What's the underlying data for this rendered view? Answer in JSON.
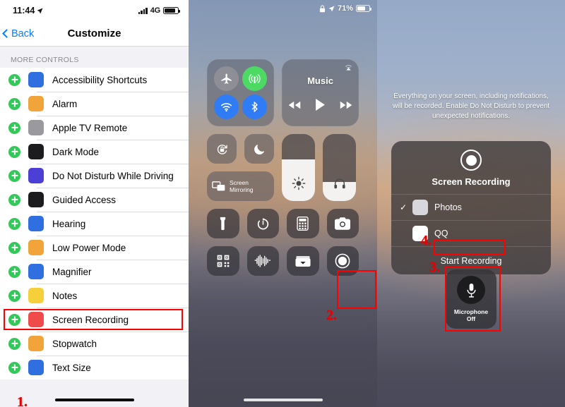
{
  "panel1": {
    "status": {
      "time": "11:44",
      "location_icon": "location-arrow-icon",
      "network": "4G",
      "signal_icon": "signal-bars-icon",
      "battery_icon": "battery-icon"
    },
    "nav": {
      "back_label": "Back",
      "title": "Customize"
    },
    "section_header": "MORE CONTROLS",
    "items": [
      {
        "label": "Accessibility Shortcuts",
        "icon": "accessibility-icon",
        "color": "#2f6fe0",
        "glyph": "ⓘ"
      },
      {
        "label": "Alarm",
        "icon": "alarm-icon",
        "color": "#f0a43a",
        "glyph": "⏰"
      },
      {
        "label": "Apple TV Remote",
        "icon": "apple-tv-remote-icon",
        "color": "#9a9a9e",
        "glyph": "▮"
      },
      {
        "label": "Dark Mode",
        "icon": "dark-mode-icon",
        "color": "#1c1c1e",
        "glyph": "◑"
      },
      {
        "label": "Do Not Disturb While Driving",
        "icon": "car-icon",
        "color": "#4b3fd6",
        "glyph": "Ὡ7"
      },
      {
        "label": "Guided Access",
        "icon": "guided-access-icon",
        "color": "#1c1c1e",
        "glyph": "▣"
      },
      {
        "label": "Hearing",
        "icon": "hearing-icon",
        "color": "#2f6fe0",
        "glyph": "ὄ2"
      },
      {
        "label": "Low Power Mode",
        "icon": "low-power-mode-icon",
        "color": "#f0a43a",
        "glyph": "ὐB"
      },
      {
        "label": "Magnifier",
        "icon": "magnifier-icon",
        "color": "#2f6fe0",
        "glyph": "ὐD"
      },
      {
        "label": "Notes",
        "icon": "notes-icon",
        "color": "#f5d03a",
        "glyph": "ὍD"
      },
      {
        "label": "Screen Recording",
        "icon": "screen-recording-icon",
        "color": "#ef4b4b",
        "glyph": "◉"
      },
      {
        "label": "Stopwatch",
        "icon": "stopwatch-icon",
        "color": "#f0a43a",
        "glyph": "⏱"
      },
      {
        "label": "Text Size",
        "icon": "text-size-icon",
        "color": "#2f6fe0",
        "glyph": "AA"
      }
    ],
    "marker": "1.",
    "highlight_item": "Screen Recording"
  },
  "panel2": {
    "status": {
      "lock_icon": "lock-icon",
      "location_icon": "location-arrow-icon",
      "battery_percent": "71%",
      "battery_icon": "battery-icon"
    },
    "connectivity": [
      {
        "name": "airplane-mode-toggle",
        "icon": "airplane-icon",
        "state": "off",
        "color": "#8e8e96"
      },
      {
        "name": "cellular-data-toggle",
        "icon": "cellular-icon",
        "state": "on",
        "color": "#4cd964"
      },
      {
        "name": "wifi-toggle",
        "icon": "wifi-icon",
        "state": "on",
        "color": "#2f7cf6"
      },
      {
        "name": "bluetooth-toggle",
        "icon": "bluetooth-icon",
        "state": "on",
        "color": "#2f7cf6"
      }
    ],
    "music": {
      "title": "Music",
      "airplay_icon": "airplay-icon",
      "prev_icon": "rewind-icon",
      "play_icon": "play-icon",
      "next_icon": "fast-forward-icon"
    },
    "rotation_lock": {
      "label": "rotation-lock-toggle",
      "icon": "rotation-lock-icon"
    },
    "do_not_disturb": {
      "label": "do-not-disturb-toggle",
      "icon": "moon-icon"
    },
    "screen_mirroring": {
      "line1": "Screen",
      "line2": "Mirroring",
      "icon": "screen-mirroring-icon"
    },
    "brightness": {
      "icon": "brightness-icon",
      "level": 62
    },
    "volume": {
      "icon": "headphones-icon",
      "level": 28
    },
    "tiles_row3": [
      {
        "name": "flashlight-tile",
        "icon": "flashlight-icon"
      },
      {
        "name": "timer-tile",
        "icon": "timer-icon"
      },
      {
        "name": "calculator-tile",
        "icon": "calculator-icon"
      },
      {
        "name": "camera-tile",
        "icon": "camera-icon"
      }
    ],
    "tiles_row4": [
      {
        "name": "qr-scanner-tile",
        "icon": "qr-code-icon"
      },
      {
        "name": "hearing-tile",
        "icon": "sound-wave-icon"
      },
      {
        "name": "wallet-tile",
        "icon": "wallet-icon"
      },
      {
        "name": "screen-recording-tile",
        "icon": "record-icon"
      }
    ],
    "marker": "2.",
    "highlight_tile": "screen-recording-tile"
  },
  "panel3": {
    "note": "Everything on your screen, including notifications, will be recorded. Enable Do Not Disturb to prevent unexpected notifications.",
    "sheet": {
      "title": "Screen Recording",
      "record_icon": "record-icon",
      "options": [
        {
          "label": "Photos",
          "icon": "photos-icon",
          "checked": true,
          "check_glyph": "✓"
        },
        {
          "label": "QQ",
          "icon": "qq-icon",
          "checked": false,
          "check_glyph": ""
        }
      ],
      "action_label": "Start Recording"
    },
    "microphone": {
      "icon": "microphone-icon",
      "line1": "Microphone",
      "line2": "Off"
    },
    "marker_mic": "3.",
    "marker_start": "4."
  },
  "colors": {
    "highlight": "#ff0000",
    "marker": "#e60000",
    "accent_blue": "#0a7cff",
    "green_add": "#34c759"
  }
}
